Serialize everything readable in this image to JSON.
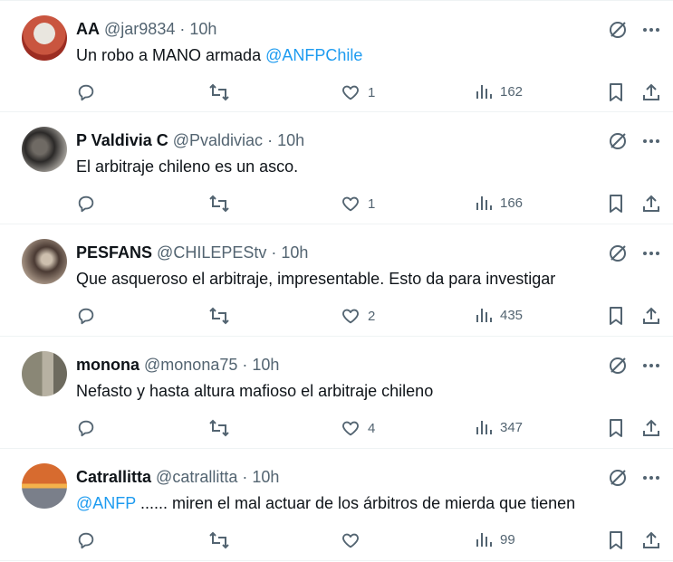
{
  "tweets": [
    {
      "name": "AA",
      "handle": "@jar9834",
      "dot": "·",
      "time": "10h",
      "text_before": "Un robo a MANO armada ",
      "mention": "@ANFPChile",
      "text_after": "",
      "likes": "1",
      "views": "162",
      "avatar_colors": [
        "#c9553f",
        "#e9e6df"
      ]
    },
    {
      "name": "P Valdivia C",
      "handle": "@Pvaldiviac",
      "dot": "·",
      "time": "10h",
      "text_before": "El arbitraje chileno es un asco.",
      "mention": "",
      "text_after": "",
      "likes": "1",
      "views": "166",
      "avatar_colors": [
        "#2b2928",
        "#b9b5ae"
      ]
    },
    {
      "name": "PESFANS",
      "handle": "@CHILEPEStv",
      "dot": "·",
      "time": "10h",
      "text_before": "Que asqueroso el arbitraje, impresentable. Esto da para investigar",
      "mention": "",
      "text_after": "",
      "likes": "2",
      "views": "435",
      "avatar_colors": [
        "#4a3a33",
        "#cdbfae"
      ]
    },
    {
      "name": "monona",
      "handle": "@monona75",
      "dot": "·",
      "time": "10h",
      "text_before": "Nefasto y hasta altura mafioso el arbitraje chileno",
      "mention": "",
      "text_after": "",
      "likes": "4",
      "views": "347",
      "avatar_colors": [
        "#8a8776",
        "#b7b1a2"
      ]
    },
    {
      "name": "Catrallitta",
      "handle": "@catrallitta",
      "dot": "·",
      "time": "10h",
      "text_before": "",
      "mention": "@ANFP",
      "text_after": " ...... miren el mal actuar de los árbitros de mierda que tienen",
      "likes": "",
      "views": "99",
      "avatar_colors": [
        "#d76b2f",
        "#f4b24b"
      ]
    }
  ],
  "icons": {
    "grok": "grok-icon",
    "more": "more-icon",
    "reply": "reply-icon",
    "retweet": "retweet-icon",
    "like": "like-icon",
    "views": "views-icon",
    "bookmark": "bookmark-icon",
    "share": "share-icon"
  },
  "colors": {
    "text": "#0f1419",
    "muted": "#536471",
    "mention": "#1d9bf0",
    "divider": "#eff3f4"
  }
}
